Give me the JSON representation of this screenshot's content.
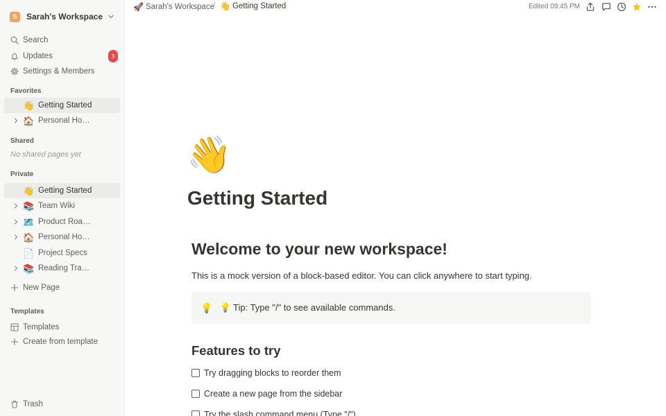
{
  "sidebar": {
    "workspace": {
      "initial": "S",
      "name": "Sarah's Workspace",
      "color": "#f3a35b"
    },
    "nav": {
      "search": "Search",
      "updates": "Updates",
      "updates_count": "3",
      "settings": "Settings & Members"
    },
    "favorites": {
      "label": "Favorites",
      "items": [
        {
          "emoji": "👋",
          "label": "Getting Started"
        },
        {
          "emoji": "🏠",
          "label": "Personal Home"
        }
      ]
    },
    "shared": {
      "label": "Shared",
      "empty": "No shared pages yet"
    },
    "private": {
      "label": "Private",
      "items": [
        {
          "emoji": "👋",
          "label": "Getting Started"
        },
        {
          "emoji": "📚",
          "label": "Team Wiki"
        },
        {
          "emoji": "🗺️",
          "label": "Product Roadmap"
        },
        {
          "emoji": "🏠",
          "label": "Personal Home"
        },
        {
          "emoji": "📄",
          "label": "Project Specs"
        },
        {
          "emoji": "📚",
          "label": "Reading Tracker"
        }
      ],
      "new_page": "New Page"
    },
    "templates": {
      "label": "Templates",
      "item": "Templates",
      "create": "Create from template"
    },
    "trash": "Trash"
  },
  "topbar": {
    "crumb_workspace_emoji": "🚀",
    "crumb_workspace": "Sarah's Workspace",
    "separator": "/",
    "crumb_page_emoji": "👋",
    "crumb_page": "Getting Started",
    "edited": "Edited 09:45 PM",
    "star_color": "#f5c518"
  },
  "page": {
    "emoji": "👋",
    "title": "Getting Started",
    "heading1": "Welcome to your new workspace!",
    "paragraph": "This is a mock version of a block-based editor. You can click anywhere to start typing.",
    "callout": {
      "emoji": "💡",
      "text": "💡 Tip: Type \"/\" to see available commands."
    },
    "heading2": "Features to try",
    "todos": [
      "Try dragging blocks to reorder them",
      "Create a new page from the sidebar",
      "Try the slash command menu (Type \"/\")"
    ]
  }
}
